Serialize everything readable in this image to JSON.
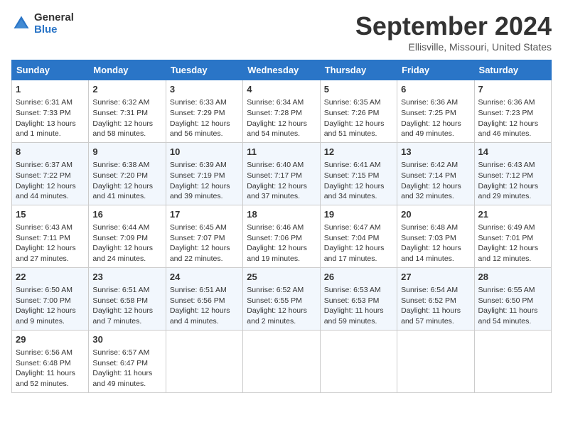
{
  "logo": {
    "line1": "General",
    "line2": "Blue"
  },
  "title": "September 2024",
  "location": "Ellisville, Missouri, United States",
  "days_of_week": [
    "Sunday",
    "Monday",
    "Tuesday",
    "Wednesday",
    "Thursday",
    "Friday",
    "Saturday"
  ],
  "weeks": [
    [
      {
        "day": "1",
        "info": "Sunrise: 6:31 AM\nSunset: 7:33 PM\nDaylight: 13 hours\nand 1 minute."
      },
      {
        "day": "2",
        "info": "Sunrise: 6:32 AM\nSunset: 7:31 PM\nDaylight: 12 hours\nand 58 minutes."
      },
      {
        "day": "3",
        "info": "Sunrise: 6:33 AM\nSunset: 7:29 PM\nDaylight: 12 hours\nand 56 minutes."
      },
      {
        "day": "4",
        "info": "Sunrise: 6:34 AM\nSunset: 7:28 PM\nDaylight: 12 hours\nand 54 minutes."
      },
      {
        "day": "5",
        "info": "Sunrise: 6:35 AM\nSunset: 7:26 PM\nDaylight: 12 hours\nand 51 minutes."
      },
      {
        "day": "6",
        "info": "Sunrise: 6:36 AM\nSunset: 7:25 PM\nDaylight: 12 hours\nand 49 minutes."
      },
      {
        "day": "7",
        "info": "Sunrise: 6:36 AM\nSunset: 7:23 PM\nDaylight: 12 hours\nand 46 minutes."
      }
    ],
    [
      {
        "day": "8",
        "info": "Sunrise: 6:37 AM\nSunset: 7:22 PM\nDaylight: 12 hours\nand 44 minutes."
      },
      {
        "day": "9",
        "info": "Sunrise: 6:38 AM\nSunset: 7:20 PM\nDaylight: 12 hours\nand 41 minutes."
      },
      {
        "day": "10",
        "info": "Sunrise: 6:39 AM\nSunset: 7:19 PM\nDaylight: 12 hours\nand 39 minutes."
      },
      {
        "day": "11",
        "info": "Sunrise: 6:40 AM\nSunset: 7:17 PM\nDaylight: 12 hours\nand 37 minutes."
      },
      {
        "day": "12",
        "info": "Sunrise: 6:41 AM\nSunset: 7:15 PM\nDaylight: 12 hours\nand 34 minutes."
      },
      {
        "day": "13",
        "info": "Sunrise: 6:42 AM\nSunset: 7:14 PM\nDaylight: 12 hours\nand 32 minutes."
      },
      {
        "day": "14",
        "info": "Sunrise: 6:43 AM\nSunset: 7:12 PM\nDaylight: 12 hours\nand 29 minutes."
      }
    ],
    [
      {
        "day": "15",
        "info": "Sunrise: 6:43 AM\nSunset: 7:11 PM\nDaylight: 12 hours\nand 27 minutes."
      },
      {
        "day": "16",
        "info": "Sunrise: 6:44 AM\nSunset: 7:09 PM\nDaylight: 12 hours\nand 24 minutes."
      },
      {
        "day": "17",
        "info": "Sunrise: 6:45 AM\nSunset: 7:07 PM\nDaylight: 12 hours\nand 22 minutes."
      },
      {
        "day": "18",
        "info": "Sunrise: 6:46 AM\nSunset: 7:06 PM\nDaylight: 12 hours\nand 19 minutes."
      },
      {
        "day": "19",
        "info": "Sunrise: 6:47 AM\nSunset: 7:04 PM\nDaylight: 12 hours\nand 17 minutes."
      },
      {
        "day": "20",
        "info": "Sunrise: 6:48 AM\nSunset: 7:03 PM\nDaylight: 12 hours\nand 14 minutes."
      },
      {
        "day": "21",
        "info": "Sunrise: 6:49 AM\nSunset: 7:01 PM\nDaylight: 12 hours\nand 12 minutes."
      }
    ],
    [
      {
        "day": "22",
        "info": "Sunrise: 6:50 AM\nSunset: 7:00 PM\nDaylight: 12 hours\nand 9 minutes."
      },
      {
        "day": "23",
        "info": "Sunrise: 6:51 AM\nSunset: 6:58 PM\nDaylight: 12 hours\nand 7 minutes."
      },
      {
        "day": "24",
        "info": "Sunrise: 6:51 AM\nSunset: 6:56 PM\nDaylight: 12 hours\nand 4 minutes."
      },
      {
        "day": "25",
        "info": "Sunrise: 6:52 AM\nSunset: 6:55 PM\nDaylight: 12 hours\nand 2 minutes."
      },
      {
        "day": "26",
        "info": "Sunrise: 6:53 AM\nSunset: 6:53 PM\nDaylight: 11 hours\nand 59 minutes."
      },
      {
        "day": "27",
        "info": "Sunrise: 6:54 AM\nSunset: 6:52 PM\nDaylight: 11 hours\nand 57 minutes."
      },
      {
        "day": "28",
        "info": "Sunrise: 6:55 AM\nSunset: 6:50 PM\nDaylight: 11 hours\nand 54 minutes."
      }
    ],
    [
      {
        "day": "29",
        "info": "Sunrise: 6:56 AM\nSunset: 6:48 PM\nDaylight: 11 hours\nand 52 minutes."
      },
      {
        "day": "30",
        "info": "Sunrise: 6:57 AM\nSunset: 6:47 PM\nDaylight: 11 hours\nand 49 minutes."
      },
      {
        "day": "",
        "info": ""
      },
      {
        "day": "",
        "info": ""
      },
      {
        "day": "",
        "info": ""
      },
      {
        "day": "",
        "info": ""
      },
      {
        "day": "",
        "info": ""
      }
    ]
  ]
}
